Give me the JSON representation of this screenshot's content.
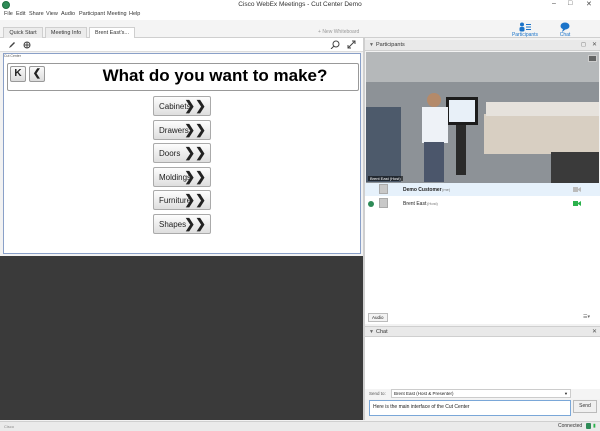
{
  "window": {
    "title": "Cisco WebEx Meetings - Cut Center Demo",
    "min": "–",
    "max": "□",
    "close": "✕"
  },
  "menu": [
    "File",
    "Edit",
    "Share",
    "View",
    "Audio",
    "Participant",
    "Meeting",
    "Help"
  ],
  "tabs": [
    {
      "label": "Quick Start",
      "active": false
    },
    {
      "label": "Meeting Info",
      "active": false
    },
    {
      "label": "Brent East's...",
      "active": true
    }
  ],
  "toolbar": {
    "new_whiteboard": "New Whiteboard",
    "participants_label": "Participants",
    "chat_label": "Chat"
  },
  "share": {
    "window_label": "Cut Center",
    "question": "What do you want to make?",
    "first_btn": "K",
    "back_btn": "❮",
    "chevron": "❯❯",
    "choices": [
      "Cabinets",
      "Drawers",
      "Doors",
      "Moldings",
      "Furniture",
      "Shapes"
    ]
  },
  "participants": {
    "header": "Participants",
    "video_caption": "Brent East (Host)",
    "list": [
      {
        "name": "Demo Customer",
        "role": "(me)"
      },
      {
        "name": "Brent East",
        "role": "(Host)"
      }
    ]
  },
  "audio": {
    "label": "Audio"
  },
  "chat": {
    "header": "Chat",
    "send_to_label": "Send to:",
    "send_to_value": "Brent East (Host & Presenter)",
    "input_value": "Here is the main interface of the Cut Center",
    "send_label": "Send"
  },
  "status": {
    "connected": "Connected",
    "left_label": "Cisco"
  },
  "colors": {
    "accent": "#1a73c9",
    "video_green": "#2bb24c"
  }
}
